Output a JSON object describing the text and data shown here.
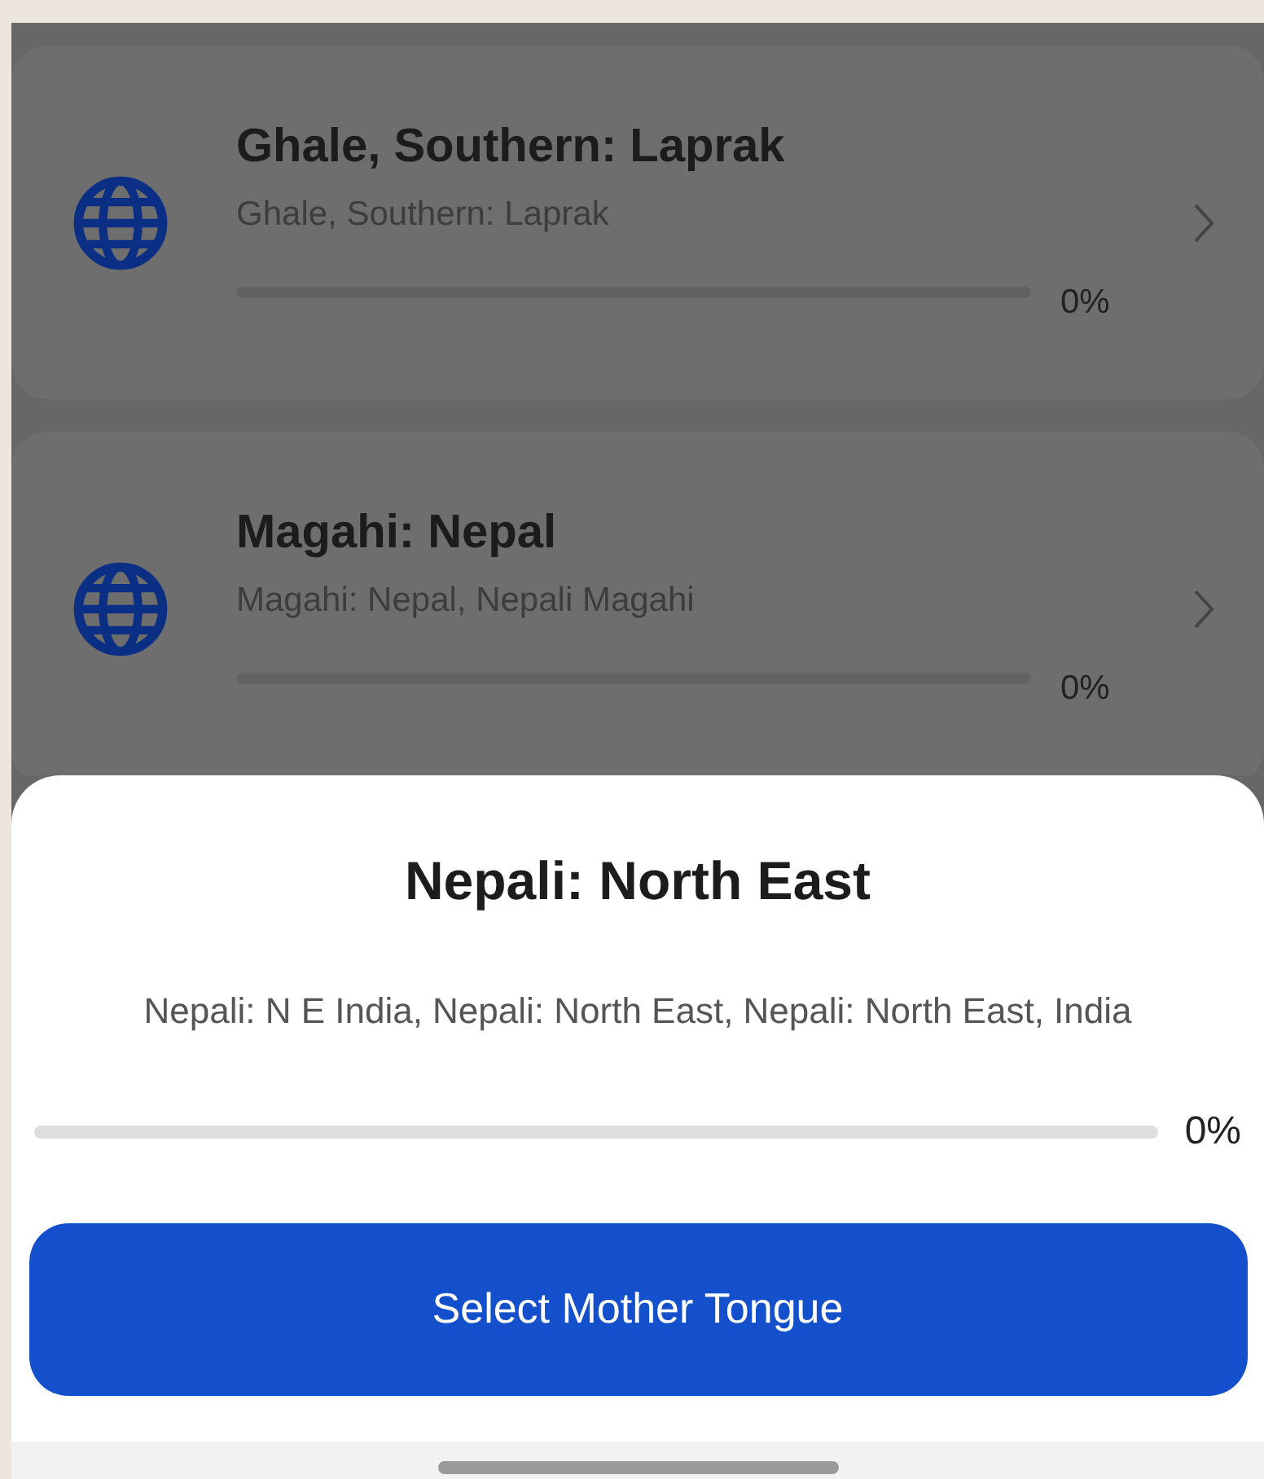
{
  "languages": [
    {
      "name": "Ghale, Southern: Laprak",
      "alternates": "Ghale, Southern: Laprak",
      "level": 0,
      "percent": "0%"
    },
    {
      "name": "Magahi: Nepal",
      "alternates": "Magahi: Nepal, Nepali Magahi",
      "level": 0,
      "percent": "0%"
    }
  ],
  "sheet": {
    "title": "Nepali: North East",
    "alternates": "Nepali: N E India, Nepali: North East, Nepali: North East, India",
    "level": 0,
    "percent": "0%",
    "button": "Select Mother Tongue"
  }
}
